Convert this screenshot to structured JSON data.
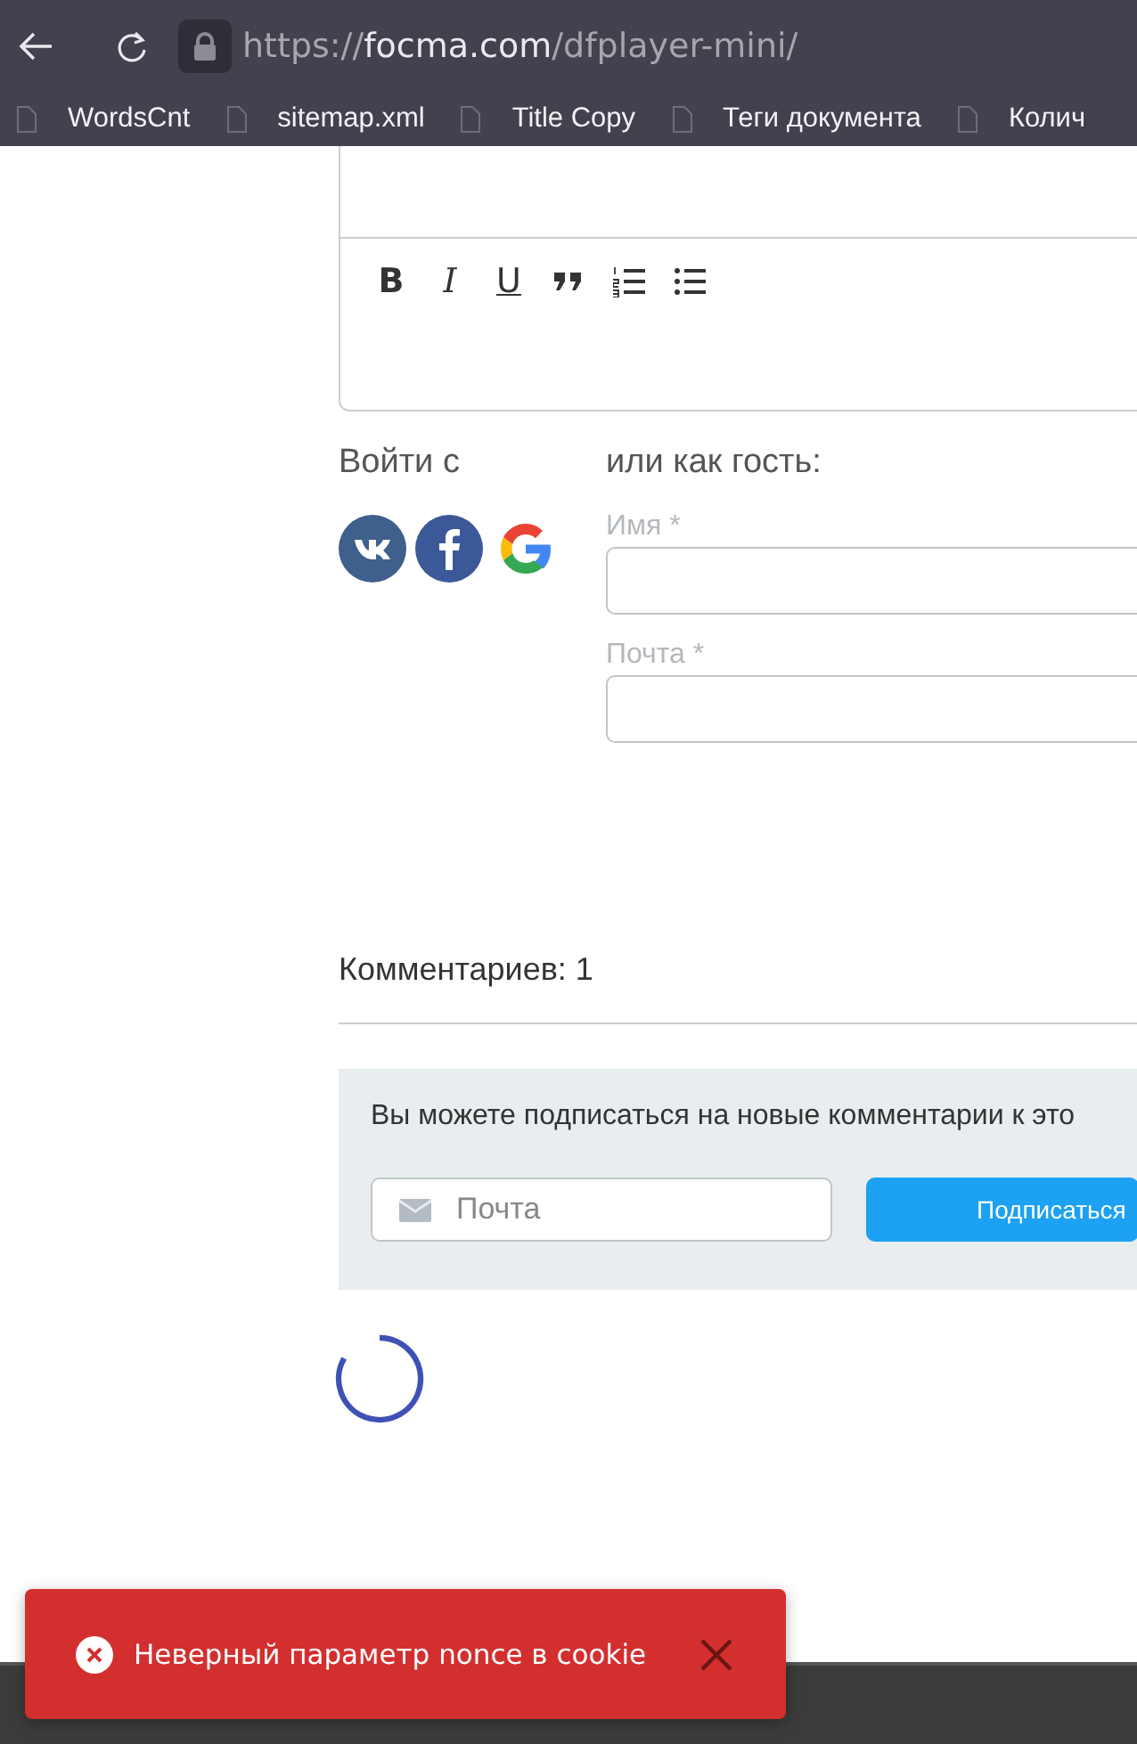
{
  "browser": {
    "url": {
      "scheme": "https://",
      "host": "focma.com",
      "path": "/dfplayer-mini/"
    },
    "bookmarks": [
      {
        "label": "WordsCnt"
      },
      {
        "label": "sitemap.xml"
      },
      {
        "label": "Title Copy"
      },
      {
        "label": "Теги документа"
      },
      {
        "label": "Колич"
      }
    ]
  },
  "editor": {
    "toolbar": [
      {
        "kind": "bold",
        "label": "B"
      },
      {
        "kind": "italic",
        "label": "I"
      },
      {
        "kind": "underline",
        "label": "U"
      },
      {
        "kind": "quote"
      },
      {
        "kind": "ordered-list"
      },
      {
        "kind": "bullet-list"
      }
    ]
  },
  "login": {
    "title": "Войти с",
    "providers": [
      {
        "kind": "vk"
      },
      {
        "kind": "facebook"
      },
      {
        "kind": "google"
      }
    ]
  },
  "guest": {
    "title": "или как гость:",
    "fields": [
      {
        "label": "Имя *"
      },
      {
        "label": "Почта *"
      }
    ]
  },
  "comments": {
    "count_label": "Комментариев: 1"
  },
  "subscribe": {
    "text": "Вы можете подписаться на новые комментарии к это",
    "email_placeholder": "Почта",
    "button": "Подписаться"
  },
  "toast": {
    "kind": "error",
    "message": "Неверный параметр nonce в cookie"
  }
}
